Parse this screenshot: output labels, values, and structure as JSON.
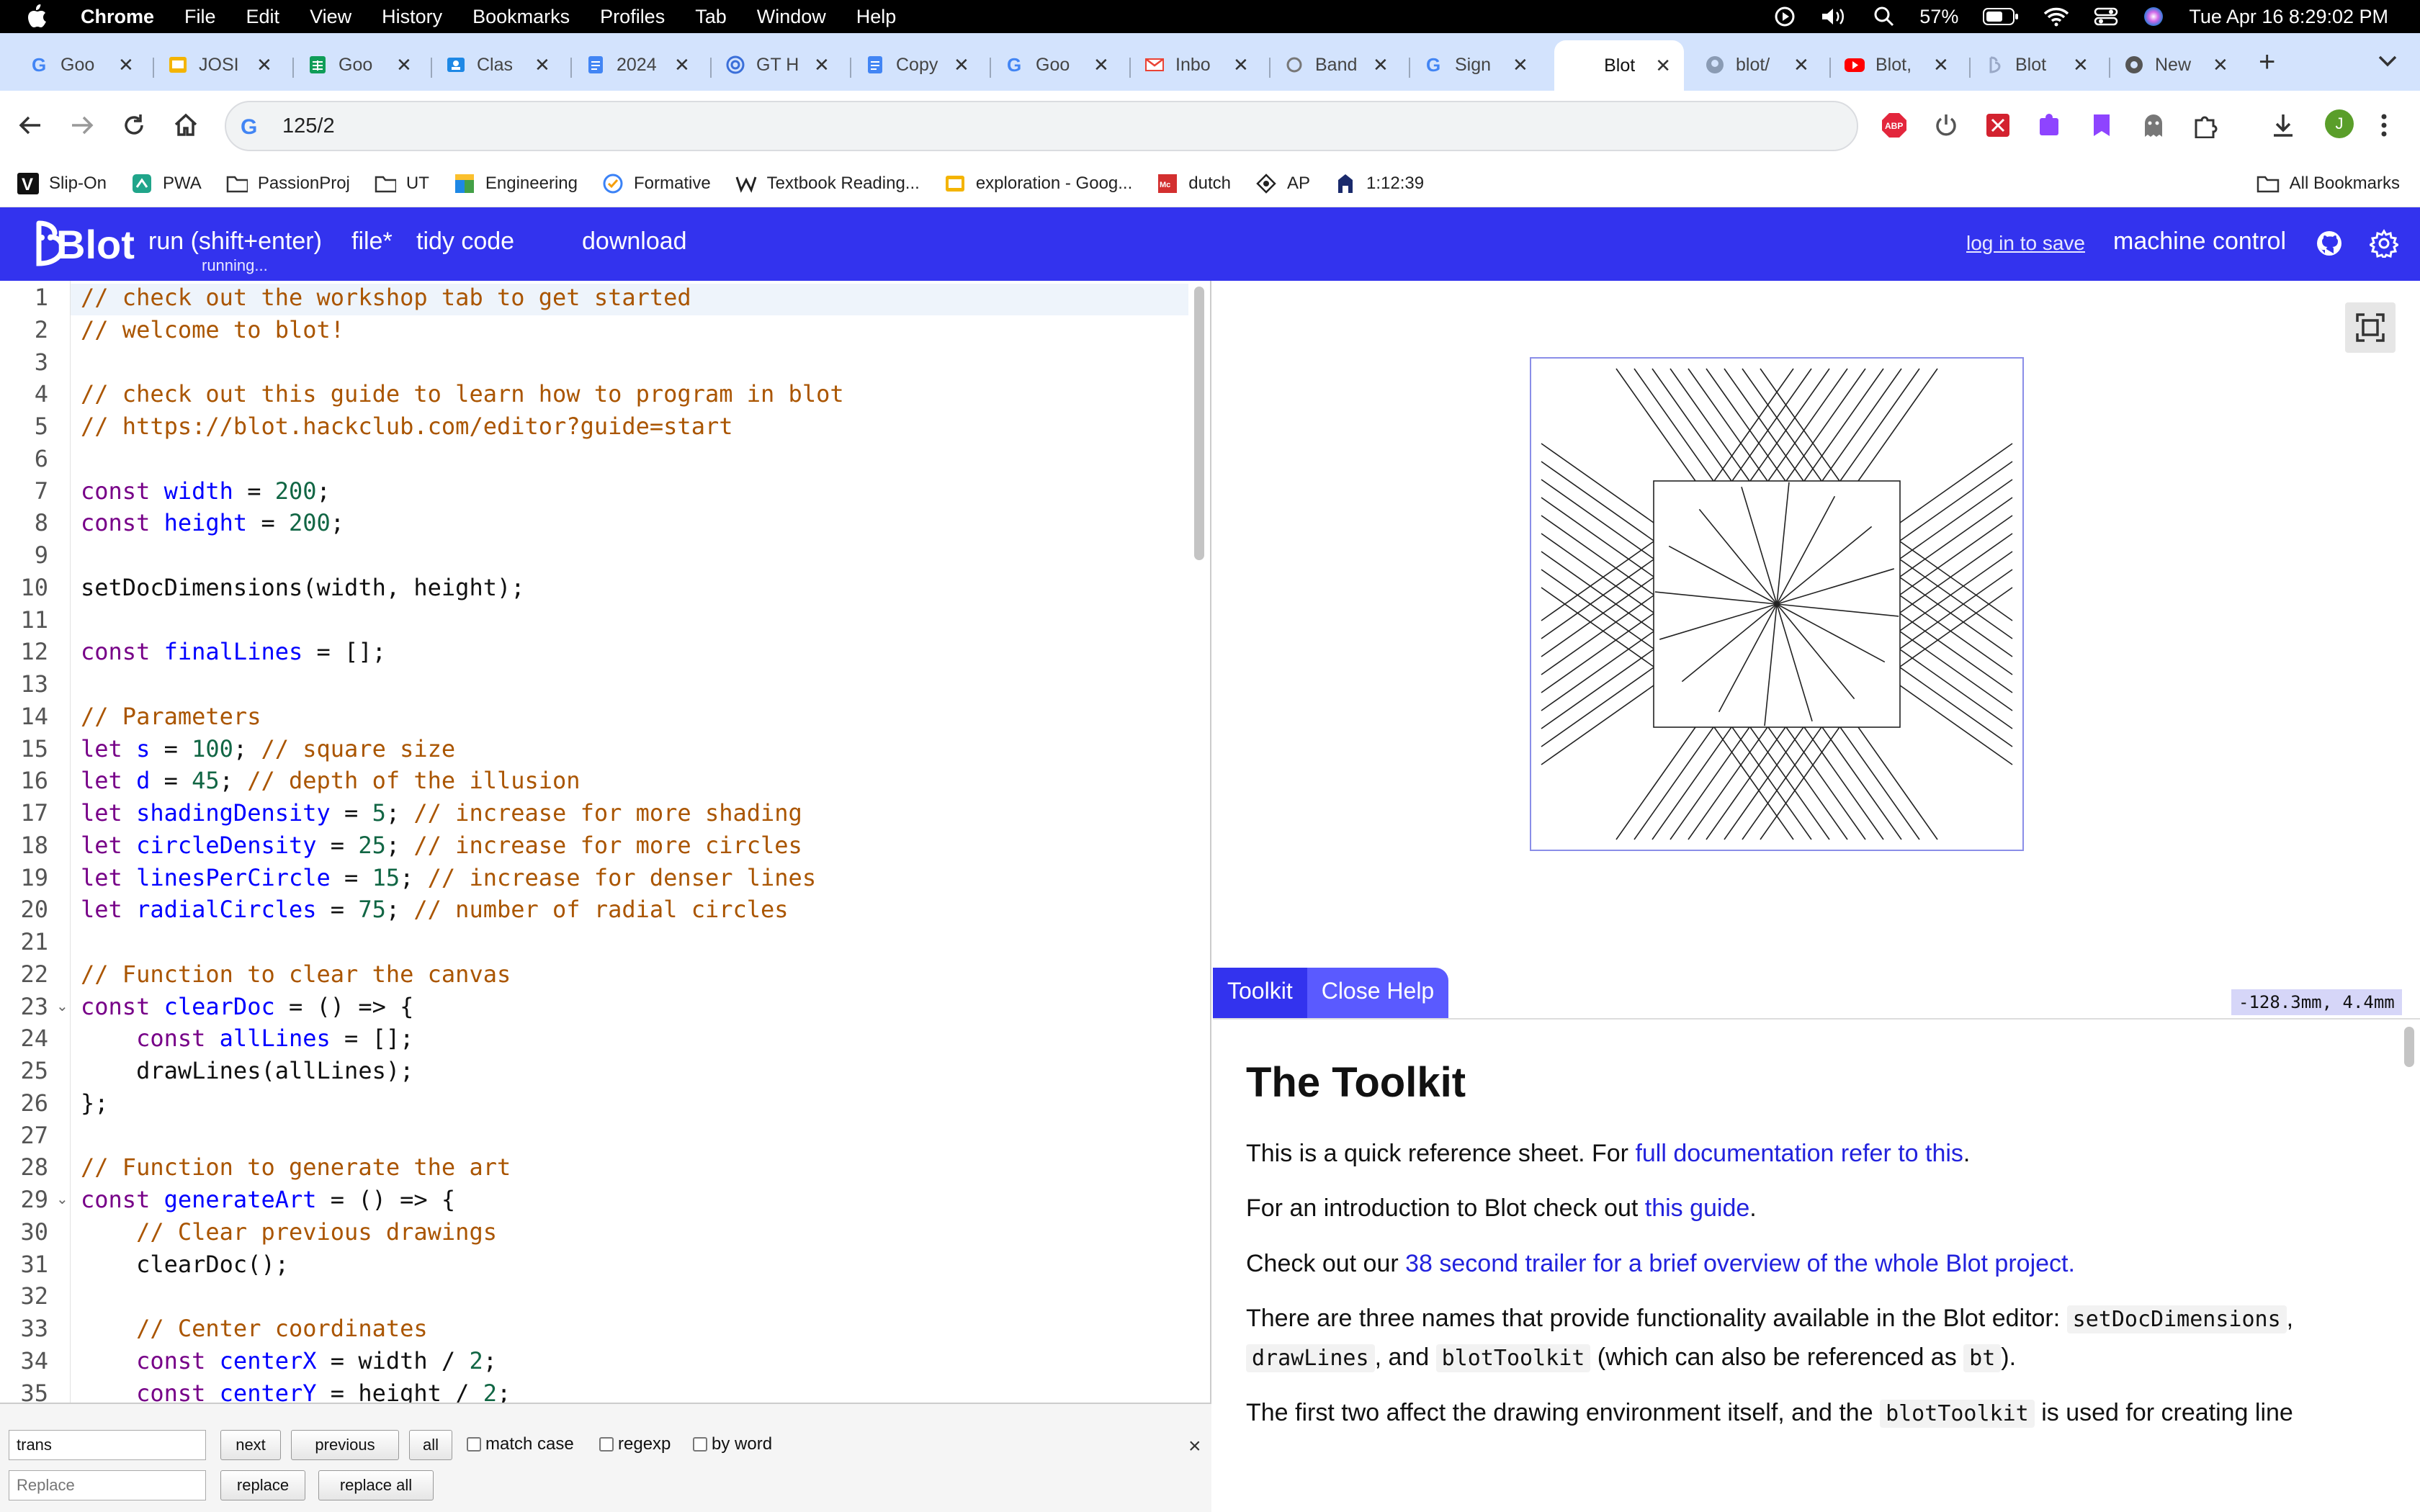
{
  "menubar": {
    "app": "Chrome",
    "items": [
      "File",
      "Edit",
      "View",
      "History",
      "Bookmarks",
      "Profiles",
      "Tab",
      "Window",
      "Help"
    ],
    "battery": "57%",
    "clock": "Tue Apr 16  8:29:02 PM"
  },
  "tabs": [
    {
      "title": "Goo",
      "icon": "google-icon"
    },
    {
      "title": "JOSI",
      "icon": "slides-icon"
    },
    {
      "title": "Goo",
      "icon": "sheets-icon"
    },
    {
      "title": "Clas",
      "icon": "classroom-icon"
    },
    {
      "title": "2024",
      "icon": "docs-icon"
    },
    {
      "title": "GT H",
      "icon": "tracker-icon"
    },
    {
      "title": "Copy",
      "icon": "docs-icon"
    },
    {
      "title": "Goo",
      "icon": "google-icon"
    },
    {
      "title": "Inbo",
      "icon": "gmail-icon"
    },
    {
      "title": "Band",
      "icon": "band-icon"
    },
    {
      "title": "Sign",
      "icon": "google-icon"
    },
    {
      "title": "Blot",
      "icon": "blot-icon",
      "active": true
    },
    {
      "title": "blot/",
      "icon": "github-icon"
    },
    {
      "title": "Blot,",
      "icon": "youtube-icon"
    },
    {
      "title": "Blot",
      "icon": "blot-icon"
    },
    {
      "title": "New",
      "icon": "chrome-icon"
    }
  ],
  "address": {
    "url": "125/2"
  },
  "bookmarks": [
    {
      "label": "Slip-On",
      "icon": "vans-icon"
    },
    {
      "label": "PWA",
      "icon": "pwa-icon"
    },
    {
      "label": "PassionProj",
      "icon": "folder-icon"
    },
    {
      "label": "UT",
      "icon": "folder-icon"
    },
    {
      "label": "Engineering",
      "icon": "engineering-icon"
    },
    {
      "label": "Formative",
      "icon": "formative-icon"
    },
    {
      "label": "Textbook Reading...",
      "icon": "textbook-icon"
    },
    {
      "label": "exploration - Goog...",
      "icon": "slides-icon"
    },
    {
      "label": "dutch",
      "icon": "mcgraw-icon"
    },
    {
      "label": "AP",
      "icon": "ap-icon"
    },
    {
      "label": "1:12:39",
      "icon": "timer-icon"
    }
  ],
  "all_bookmarks": "All Bookmarks",
  "blot": {
    "logo": "Blot",
    "run": "run (shift+enter)",
    "run_status": "running...",
    "file": "file*",
    "tidy": "tidy code",
    "download": "download",
    "login": "log in to save",
    "machine": "machine control"
  },
  "editor": {
    "line_numbers": [
      "1",
      "2",
      "3",
      "4",
      "5",
      "6",
      "7",
      "8",
      "9",
      "10",
      "11",
      "12",
      "13",
      "14",
      "15",
      "16",
      "17",
      "18",
      "19",
      "20",
      "21",
      "22",
      "23",
      "24",
      "25",
      "26",
      "27",
      "28",
      "29",
      "30",
      "31",
      "32",
      "33",
      "34",
      "35"
    ],
    "fold_lines": [
      23,
      29
    ],
    "lines": [
      [
        [
          "cm",
          "// check out the workshop tab to get started"
        ]
      ],
      [
        [
          "cm",
          "// welcome to blot!"
        ]
      ],
      [],
      [
        [
          "cm",
          "// check out this guide to learn how to program in blot"
        ]
      ],
      [
        [
          "cm",
          "// https://blot.hackclub.com/editor?guide=start"
        ]
      ],
      [],
      [
        [
          "kw",
          "const"
        ],
        [
          "op",
          " "
        ],
        [
          "def",
          "width"
        ],
        [
          "op",
          " = "
        ],
        [
          "num",
          "200"
        ],
        [
          "op",
          ";"
        ]
      ],
      [
        [
          "kw",
          "const"
        ],
        [
          "op",
          " "
        ],
        [
          "def",
          "height"
        ],
        [
          "op",
          " = "
        ],
        [
          "num",
          "200"
        ],
        [
          "op",
          ";"
        ]
      ],
      [],
      [
        [
          "op",
          "setDocDimensions(width, height);"
        ]
      ],
      [],
      [
        [
          "kw",
          "const"
        ],
        [
          "op",
          " "
        ],
        [
          "def",
          "finalLines"
        ],
        [
          "op",
          " = [];"
        ]
      ],
      [],
      [
        [
          "cm",
          "// Parameters"
        ]
      ],
      [
        [
          "kw",
          "let"
        ],
        [
          "op",
          " "
        ],
        [
          "def",
          "s"
        ],
        [
          "op",
          " = "
        ],
        [
          "num",
          "100"
        ],
        [
          "op",
          "; "
        ],
        [
          "cm",
          "// square size"
        ]
      ],
      [
        [
          "kw",
          "let"
        ],
        [
          "op",
          " "
        ],
        [
          "def",
          "d"
        ],
        [
          "op",
          " = "
        ],
        [
          "num",
          "45"
        ],
        [
          "op",
          "; "
        ],
        [
          "cm",
          "// depth of the illusion"
        ]
      ],
      [
        [
          "kw",
          "let"
        ],
        [
          "op",
          " "
        ],
        [
          "def",
          "shadingDensity"
        ],
        [
          "op",
          " = "
        ],
        [
          "num",
          "5"
        ],
        [
          "op",
          "; "
        ],
        [
          "cm",
          "// increase for more shading"
        ]
      ],
      [
        [
          "kw",
          "let"
        ],
        [
          "op",
          " "
        ],
        [
          "def",
          "circleDensity"
        ],
        [
          "op",
          " = "
        ],
        [
          "num",
          "25"
        ],
        [
          "op",
          "; "
        ],
        [
          "cm",
          "// increase for more circles"
        ]
      ],
      [
        [
          "kw",
          "let"
        ],
        [
          "op",
          " "
        ],
        [
          "def",
          "linesPerCircle"
        ],
        [
          "op",
          " = "
        ],
        [
          "num",
          "15"
        ],
        [
          "op",
          "; "
        ],
        [
          "cm",
          "// increase for denser lines"
        ]
      ],
      [
        [
          "kw",
          "let"
        ],
        [
          "op",
          " "
        ],
        [
          "def",
          "radialCircles"
        ],
        [
          "op",
          " = "
        ],
        [
          "num",
          "75"
        ],
        [
          "op",
          "; "
        ],
        [
          "cm",
          "// number of radial circles"
        ]
      ],
      [],
      [
        [
          "cm",
          "// Function to clear the canvas"
        ]
      ],
      [
        [
          "kw",
          "const"
        ],
        [
          "op",
          " "
        ],
        [
          "def",
          "clearDoc"
        ],
        [
          "op",
          " = () => {"
        ]
      ],
      [
        [
          "op",
          "    "
        ],
        [
          "kw",
          "const"
        ],
        [
          "op",
          " "
        ],
        [
          "def",
          "allLines"
        ],
        [
          "op",
          " = [];"
        ]
      ],
      [
        [
          "op",
          "    drawLines(allLines);"
        ]
      ],
      [
        [
          "op",
          "};"
        ]
      ],
      [],
      [
        [
          "cm",
          "// Function to generate the art"
        ]
      ],
      [
        [
          "kw",
          "const"
        ],
        [
          "op",
          " "
        ],
        [
          "def",
          "generateArt"
        ],
        [
          "op",
          " = () => {"
        ]
      ],
      [
        [
          "op",
          "    "
        ],
        [
          "cm",
          "// Clear previous drawings"
        ]
      ],
      [
        [
          "op",
          "    clearDoc();"
        ]
      ],
      [],
      [
        [
          "op",
          "    "
        ],
        [
          "cm",
          "// Center coordinates"
        ]
      ],
      [
        [
          "op",
          "    "
        ],
        [
          "kw",
          "const"
        ],
        [
          "op",
          " "
        ],
        [
          "def",
          "centerX"
        ],
        [
          "op",
          " = width / "
        ],
        [
          "num",
          "2"
        ],
        [
          "op",
          ";"
        ]
      ],
      [
        [
          "op",
          "    "
        ],
        [
          "kw",
          "const"
        ],
        [
          "op",
          " "
        ],
        [
          "def",
          "centerY"
        ],
        [
          "op",
          " = height / "
        ],
        [
          "num",
          "2"
        ],
        [
          "op",
          ";"
        ]
      ]
    ]
  },
  "search": {
    "query": "trans",
    "replace_placeholder": "Replace",
    "next": "next",
    "previous": "previous",
    "all": "all",
    "match_case": "match case",
    "regexp": "regexp",
    "by_word": "by word",
    "replace": "replace",
    "replace_all": "replace all",
    "close": "×"
  },
  "viewer": {
    "coords": "-128.3mm,  4.4mm",
    "tab_toolkit": "Toolkit",
    "tab_close_help": "Close Help"
  },
  "help": {
    "title": "The Toolkit",
    "p1_pre": "This is a quick reference sheet. For ",
    "p1_link": "full documentation refer to this",
    "p1_post": ".",
    "p2_pre": "For an introduction to Blot check out ",
    "p2_link": "this guide",
    "p2_post": ".",
    "p3_pre": "Check out our ",
    "p3_link": "38 second trailer for a brief overview of the whole Blot project.",
    "p4_pre": "There are three names that provide functionality available in the Blot editor: ",
    "p4_code1": "setDocDimensions",
    "p4_sep1": ",",
    "p4_code2": "drawLines",
    "p4_sep2": ", and ",
    "p4_code3": "blotToolkit",
    "p4_mid": " (which can also be referenced as ",
    "p4_code4": "bt",
    "p4_post": ").",
    "p5_pre": "The first two affect the drawing environment itself, and the ",
    "p5_code": "blotToolkit",
    "p5_post": " is used for creating line"
  },
  "colors": {
    "blot_blue": "#3333ee",
    "tab_strip": "#d3e3fd",
    "keyword": "#770088",
    "definition": "#0000ff",
    "number": "#116644",
    "comment": "#aa5500"
  }
}
